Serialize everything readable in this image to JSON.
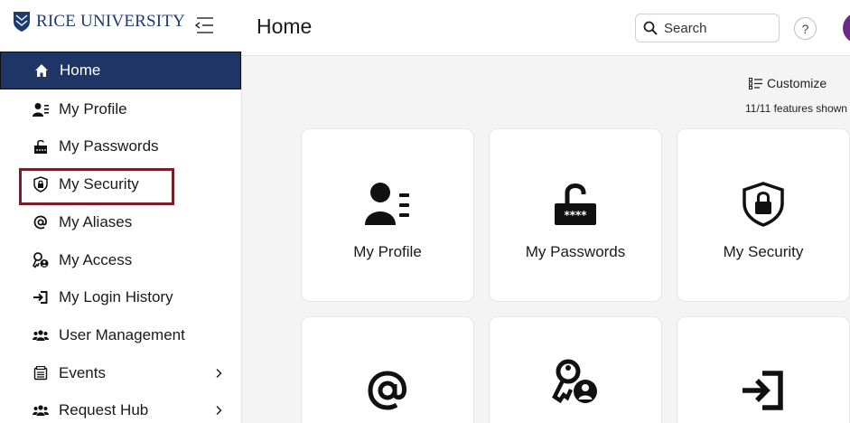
{
  "app": {
    "logo_text": "RICE UNIVERSITY",
    "brand_color": "#1e3a6e",
    "active_color": "#1e3566",
    "highlight_color": "#7a1c2a"
  },
  "header": {
    "page_title": "Home",
    "search_placeholder": "Search",
    "help_label": "?"
  },
  "sidebar": {
    "items": [
      {
        "label": "Home",
        "icon": "home-icon",
        "active": true
      },
      {
        "label": "My Profile",
        "icon": "profile-icon"
      },
      {
        "label": "My Passwords",
        "icon": "password-icon"
      },
      {
        "label": "My Security",
        "icon": "shield-lock-icon",
        "highlighted": true
      },
      {
        "label": "My Aliases",
        "icon": "at-icon"
      },
      {
        "label": "My Access",
        "icon": "key-user-icon"
      },
      {
        "label": "My Login History",
        "icon": "login-icon"
      },
      {
        "label": "User Management",
        "icon": "users-icon"
      },
      {
        "label": "Events",
        "icon": "events-icon",
        "expandable": true
      },
      {
        "label": "Request Hub",
        "icon": "users-icon",
        "expandable": true
      }
    ]
  },
  "main": {
    "customize_label": "Customize",
    "features_count": "11/11 features shown",
    "cards": [
      {
        "label": "My Profile",
        "icon": "profile-icon"
      },
      {
        "label": "My Passwords",
        "icon": "password-icon"
      },
      {
        "label": "My Security",
        "icon": "shield-lock-icon"
      },
      {
        "label": "",
        "icon": "at-icon"
      },
      {
        "label": "",
        "icon": "key-user-icon"
      },
      {
        "label": "",
        "icon": "login-icon"
      }
    ]
  }
}
